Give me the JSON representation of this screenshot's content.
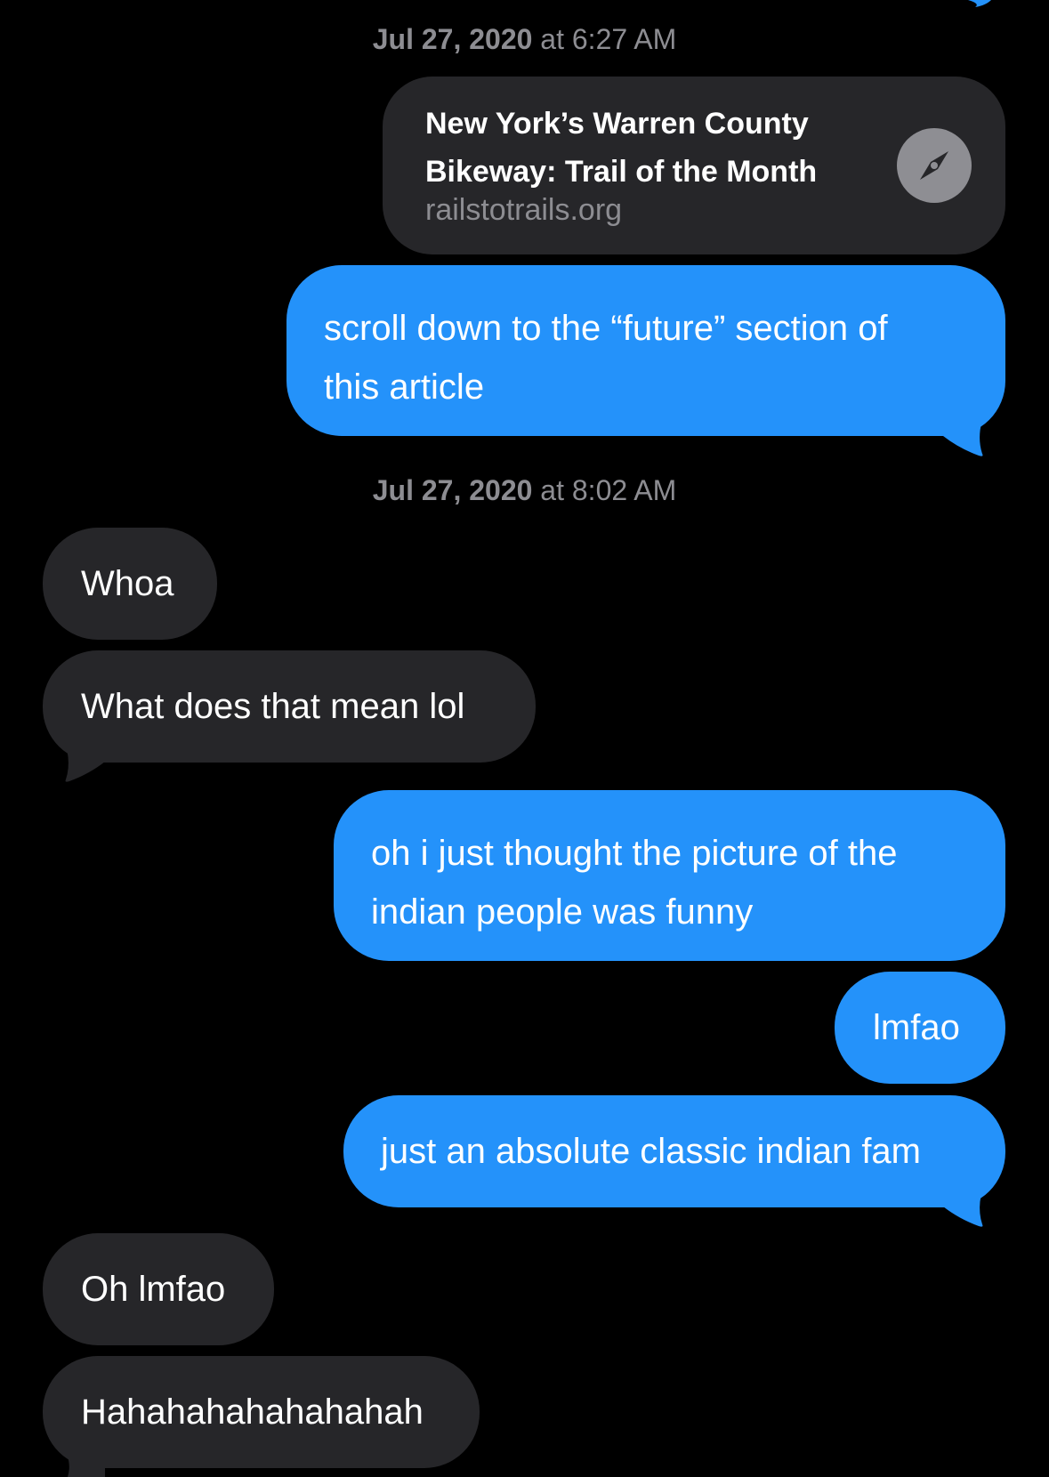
{
  "timestamps": [
    {
      "date": "Jul 27, 2020",
      "time": "at 6:27 AM"
    },
    {
      "date": "Jul 27, 2020",
      "time": "at 8:02 AM"
    }
  ],
  "link_preview": {
    "title_line1": "New York’s Warren County",
    "title_line2": "Bikeway: Trail of the Month",
    "domain": "railstotrails.org",
    "icon": "compass-icon"
  },
  "messages": [
    {
      "side": "sent",
      "lines": [
        "scroll down to the “future” section of",
        "this article"
      ]
    },
    {
      "side": "received",
      "lines": [
        "Whoa"
      ]
    },
    {
      "side": "received",
      "lines": [
        "What does that mean lol"
      ]
    },
    {
      "side": "sent",
      "lines": [
        "oh i just thought the picture of the",
        "indian people was funny"
      ]
    },
    {
      "side": "sent",
      "lines": [
        "lmfao"
      ]
    },
    {
      "side": "sent",
      "lines": [
        "just an absolute classic indian fam"
      ]
    },
    {
      "side": "received",
      "lines": [
        "Oh lmfao"
      ]
    },
    {
      "side": "received",
      "lines": [
        "Hahahahahahahahah"
      ]
    }
  ],
  "colors": {
    "background": "#000000",
    "sent_bubble": "#2492fa",
    "received_bubble": "#262629",
    "timestamp_text": "#8d8d92"
  }
}
